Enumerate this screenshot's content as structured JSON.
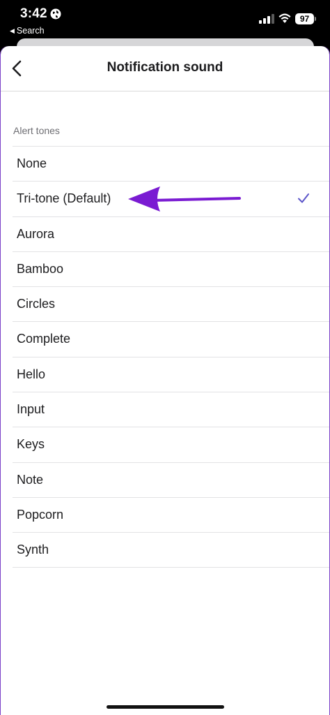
{
  "status_bar": {
    "time": "3:42",
    "back_app": "Search",
    "battery": "97"
  },
  "nav": {
    "title": "Notification sound",
    "back_icon": "chevron-left-icon"
  },
  "section": {
    "header": "Alert tones"
  },
  "tones": [
    {
      "label": "None"
    },
    {
      "label": "Tri-tone (Default)",
      "selected": true
    },
    {
      "label": "Aurora"
    },
    {
      "label": "Bamboo"
    },
    {
      "label": "Circles"
    },
    {
      "label": "Complete"
    },
    {
      "label": "Hello"
    },
    {
      "label": "Input"
    },
    {
      "label": "Keys"
    },
    {
      "label": "Note"
    },
    {
      "label": "Popcorn"
    },
    {
      "label": "Synth"
    }
  ],
  "colors": {
    "accent": "#5b55c9",
    "annotation_arrow": "#7a1bd2"
  }
}
